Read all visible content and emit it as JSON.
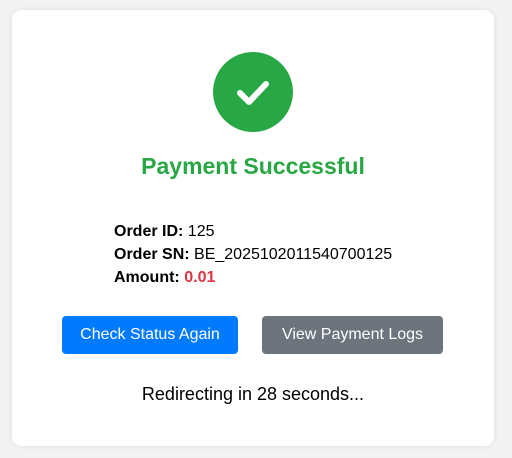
{
  "status": {
    "icon": "checkmark-icon",
    "title": "Payment Successful",
    "color": "#28a745"
  },
  "order": {
    "id_label": "Order ID:",
    "id_value": "125",
    "sn_label": "Order SN:",
    "sn_value": "BE_2025102011540700125",
    "amount_label": "Amount:",
    "amount_value": "0.01",
    "amount_color": "#dc3545"
  },
  "actions": {
    "check_status_label": "Check Status Again",
    "check_status_color": "#007bff",
    "view_logs_label": "View Payment Logs",
    "view_logs_color": "#6c757d"
  },
  "redirect": {
    "text": "Redirecting in 28 seconds..."
  }
}
